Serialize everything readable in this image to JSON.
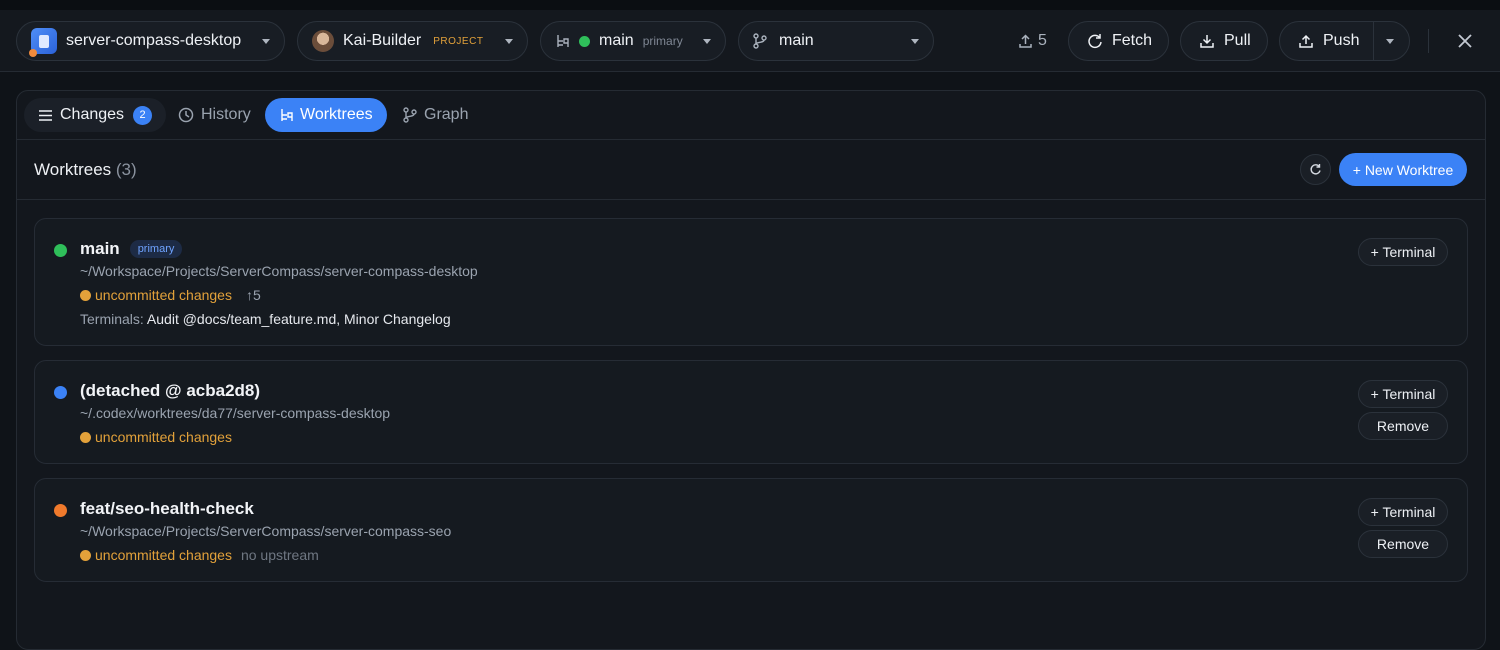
{
  "toolbar": {
    "project_name": "server-compass-desktop",
    "user_name": "Kai-Builder",
    "user_badge": "PROJECT",
    "worktree_name": "main",
    "worktree_tag": "primary",
    "branch_name": "main",
    "ahead_count": "5",
    "fetch_label": "Fetch",
    "pull_label": "Pull",
    "push_label": "Push"
  },
  "tabs": {
    "changes_label": "Changes",
    "changes_count": "2",
    "history_label": "History",
    "worktrees_label": "Worktrees",
    "graph_label": "Graph",
    "active": "Worktrees"
  },
  "worktrees": {
    "title": "Worktrees",
    "count": "(3)",
    "new_button": "+ New Worktree",
    "terminals_label": "Terminals:",
    "terminal_button": "+ Terminal",
    "remove_button": "Remove",
    "items": [
      {
        "name": "main",
        "badge": "primary",
        "path": "~/Workspace/Projects/ServerCompass/server-compass-desktop",
        "status": "uncommitted changes",
        "ahead": "↑5",
        "terminals": "Audit @docs/team_feature.md, Minor Changelog",
        "dot_color": "#2fbf5a"
      },
      {
        "name": "(detached @ acba2d8)",
        "path": "~/.codex/worktrees/da77/server-compass-desktop",
        "status": "uncommitted changes",
        "dot_color": "#3b82f6"
      },
      {
        "name": "feat/seo-health-check",
        "path": "~/Workspace/Projects/ServerCompass/server-compass-seo",
        "status": "uncommitted changes",
        "upstream": "no upstream",
        "dot_color": "#f07a2c"
      }
    ]
  },
  "colors": {
    "accent": "#3b82f6",
    "warning": "#e2a13a",
    "background": "#0f1318"
  }
}
